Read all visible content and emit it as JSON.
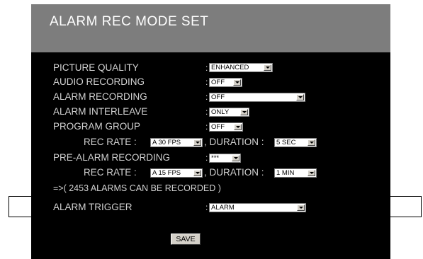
{
  "title": "ALARM REC MODE SET",
  "rows": {
    "picture_quality": {
      "label": "PICTURE QUALITY",
      "value": "ENHANCED"
    },
    "audio_recording": {
      "label": "AUDIO RECORDING",
      "value": "OFF"
    },
    "alarm_recording": {
      "label": "ALARM RECORDING",
      "value": "OFF"
    },
    "alarm_interleave": {
      "label": "ALARM INTERLEAVE",
      "value": "ONLY"
    },
    "program_group": {
      "label": "PROGRAM GROUP",
      "value": "OFF"
    },
    "pg_rec_rate": {
      "label": "REC RATE :",
      "value": "A 30 FPS",
      "duration_label": ", DURATION :",
      "duration_value": "5 SEC"
    },
    "pre_alarm_recording": {
      "label": "PRE-ALARM RECORDING",
      "value": "***"
    },
    "pre_rec_rate": {
      "label": "REC RATE :",
      "value": "A 15 FPS",
      "duration_label": ", DURATION :",
      "duration_value": "1 MIN"
    },
    "capacity_note": "=>( 2453 ALARMS CAN BE RECORDED )",
    "alarm_trigger": {
      "label": "ALARM TRIGGER",
      "value": "ALARM"
    }
  },
  "colon": ":",
  "save_label": "SAVE",
  "colors": {
    "background": "#000000",
    "header": "#7d7d7d",
    "text": "#d2d2d2"
  }
}
